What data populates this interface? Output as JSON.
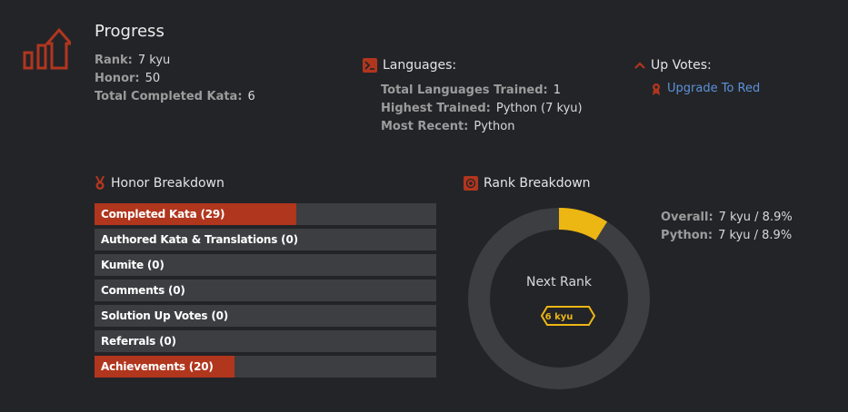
{
  "progress": {
    "title": "Progress",
    "stats": [
      {
        "label": "Rank:",
        "value": "7 kyu"
      },
      {
        "label": "Honor:",
        "value": "50"
      },
      {
        "label": "Total Completed Kata:",
        "value": "6"
      }
    ]
  },
  "languages": {
    "title": "Languages:",
    "stats": [
      {
        "label": "Total Languages Trained:",
        "value": "1"
      },
      {
        "label": "Highest Trained:",
        "value": "Python (7 kyu)"
      },
      {
        "label": "Most Recent:",
        "value": "Python"
      }
    ]
  },
  "upvotes": {
    "title": "Up Votes:",
    "link": "Upgrade To Red"
  },
  "honor_breakdown": {
    "title": "Honor Breakdown",
    "bars": [
      {
        "label": "Completed Kata (29)",
        "fraction": 0.59
      },
      {
        "label": "Authored Kata & Translations (0)",
        "fraction": 0
      },
      {
        "label": "Kumite (0)",
        "fraction": 0
      },
      {
        "label": "Comments (0)",
        "fraction": 0
      },
      {
        "label": "Solution Up Votes (0)",
        "fraction": 0
      },
      {
        "label": "Referrals (0)",
        "fraction": 0
      },
      {
        "label": "Achievements (20)",
        "fraction": 0.41
      }
    ]
  },
  "rank_breakdown": {
    "title": "Rank Breakdown",
    "center_label": "Next Rank",
    "next_rank": "6 kyu",
    "progress_percent": 8.9,
    "stats": [
      {
        "label": "Overall:",
        "value": "7 kyu / 8.9%"
      },
      {
        "label": "Python:",
        "value": "7 kyu / 8.9%"
      }
    ]
  },
  "colors": {
    "accent": "#b1361e",
    "rank_yellow": "#ecb613",
    "link_blue": "#5b92d8"
  }
}
